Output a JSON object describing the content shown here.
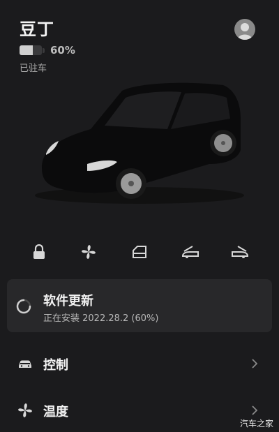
{
  "vehicle": {
    "name": "豆丁",
    "battery_percent": "60%",
    "battery_level": 0.6,
    "status": "已驻车"
  },
  "avatar_icon": "user-avatar-icon",
  "quick_controls": [
    {
      "name": "lock",
      "icon": "lock-icon"
    },
    {
      "name": "fan",
      "icon": "fan-icon"
    },
    {
      "name": "window",
      "icon": "window-icon"
    },
    {
      "name": "frunk",
      "icon": "frunk-icon"
    },
    {
      "name": "trunk",
      "icon": "trunk-icon"
    }
  ],
  "software_update": {
    "title": "软件更新",
    "status": "正在安装 2022.28.2 (60%)",
    "progress": 0.6
  },
  "menu": [
    {
      "label": "控制",
      "icon": "car-icon"
    },
    {
      "label": "温度",
      "icon": "fan-icon"
    }
  ],
  "watermark": "汽车之家",
  "colors": {
    "background": "#1b1b1d",
    "card": "#28282a",
    "text": "#f2f2f2",
    "muted": "#a8a8a8"
  }
}
